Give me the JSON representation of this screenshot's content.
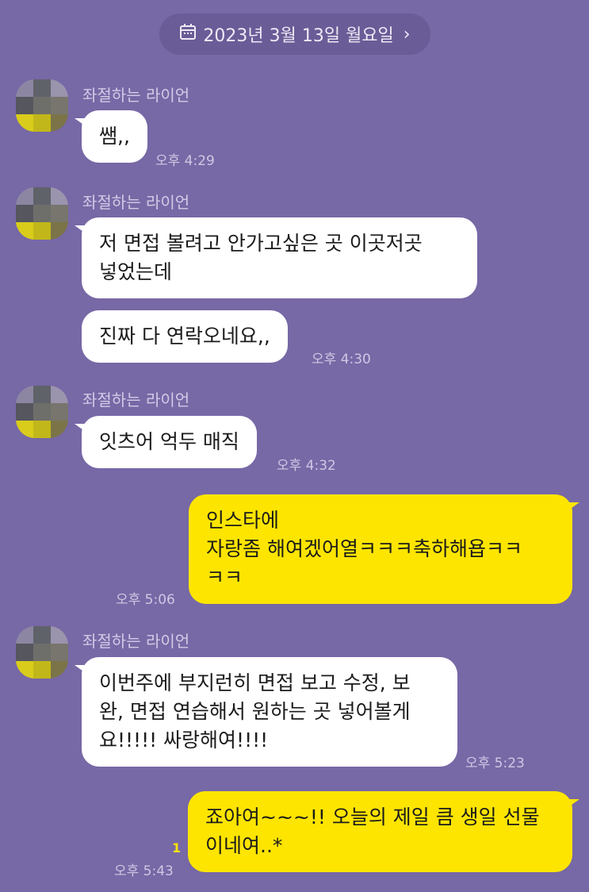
{
  "date_header": {
    "label": "2023년 3월 13일 월요일",
    "calendar_icon": "calendar-icon",
    "chevron_icon": "chevron-right-icon",
    "chevron": "›"
  },
  "colors": {
    "background": "#7768a6",
    "incoming_bubble": "#ffffff",
    "outgoing_bubble": "#fde500",
    "unread_count": "#fde500"
  },
  "messages": [
    {
      "sender": "좌절하는 라이언",
      "text": "쌤,,",
      "time": "오후 4:29"
    },
    {
      "sender": "좌절하는 라이언",
      "text": "저 면접 볼려고 안가고싶은 곳 이곳저곳\n넣었는데"
    },
    {
      "text": "진짜 다 연락오네요,,",
      "time": "오후 4:30"
    },
    {
      "sender": "좌절하는 라이언",
      "text": "잇츠어 억두 매직",
      "time": "오후 4:32"
    },
    {
      "text": "인스타에\n자랑좀 해여겠어열ㅋㅋㅋ축하해욥ㅋㅋ\nㅋㅋ",
      "time": "오후 5:06"
    },
    {
      "sender": "좌절하는 라이언",
      "text": "이번주에 부지런히 면접 보고 수정, 보\n완, 면접 연습해서 원하는 곳 넣어볼게\n요!!!!! 싸랑해여!!!!",
      "time": "오후 5:23"
    },
    {
      "text": "죠아여~~~!! 오늘의 제일 큼 생일 선물\n이네여..*",
      "time": "오후 5:43",
      "unread": "1"
    }
  ]
}
